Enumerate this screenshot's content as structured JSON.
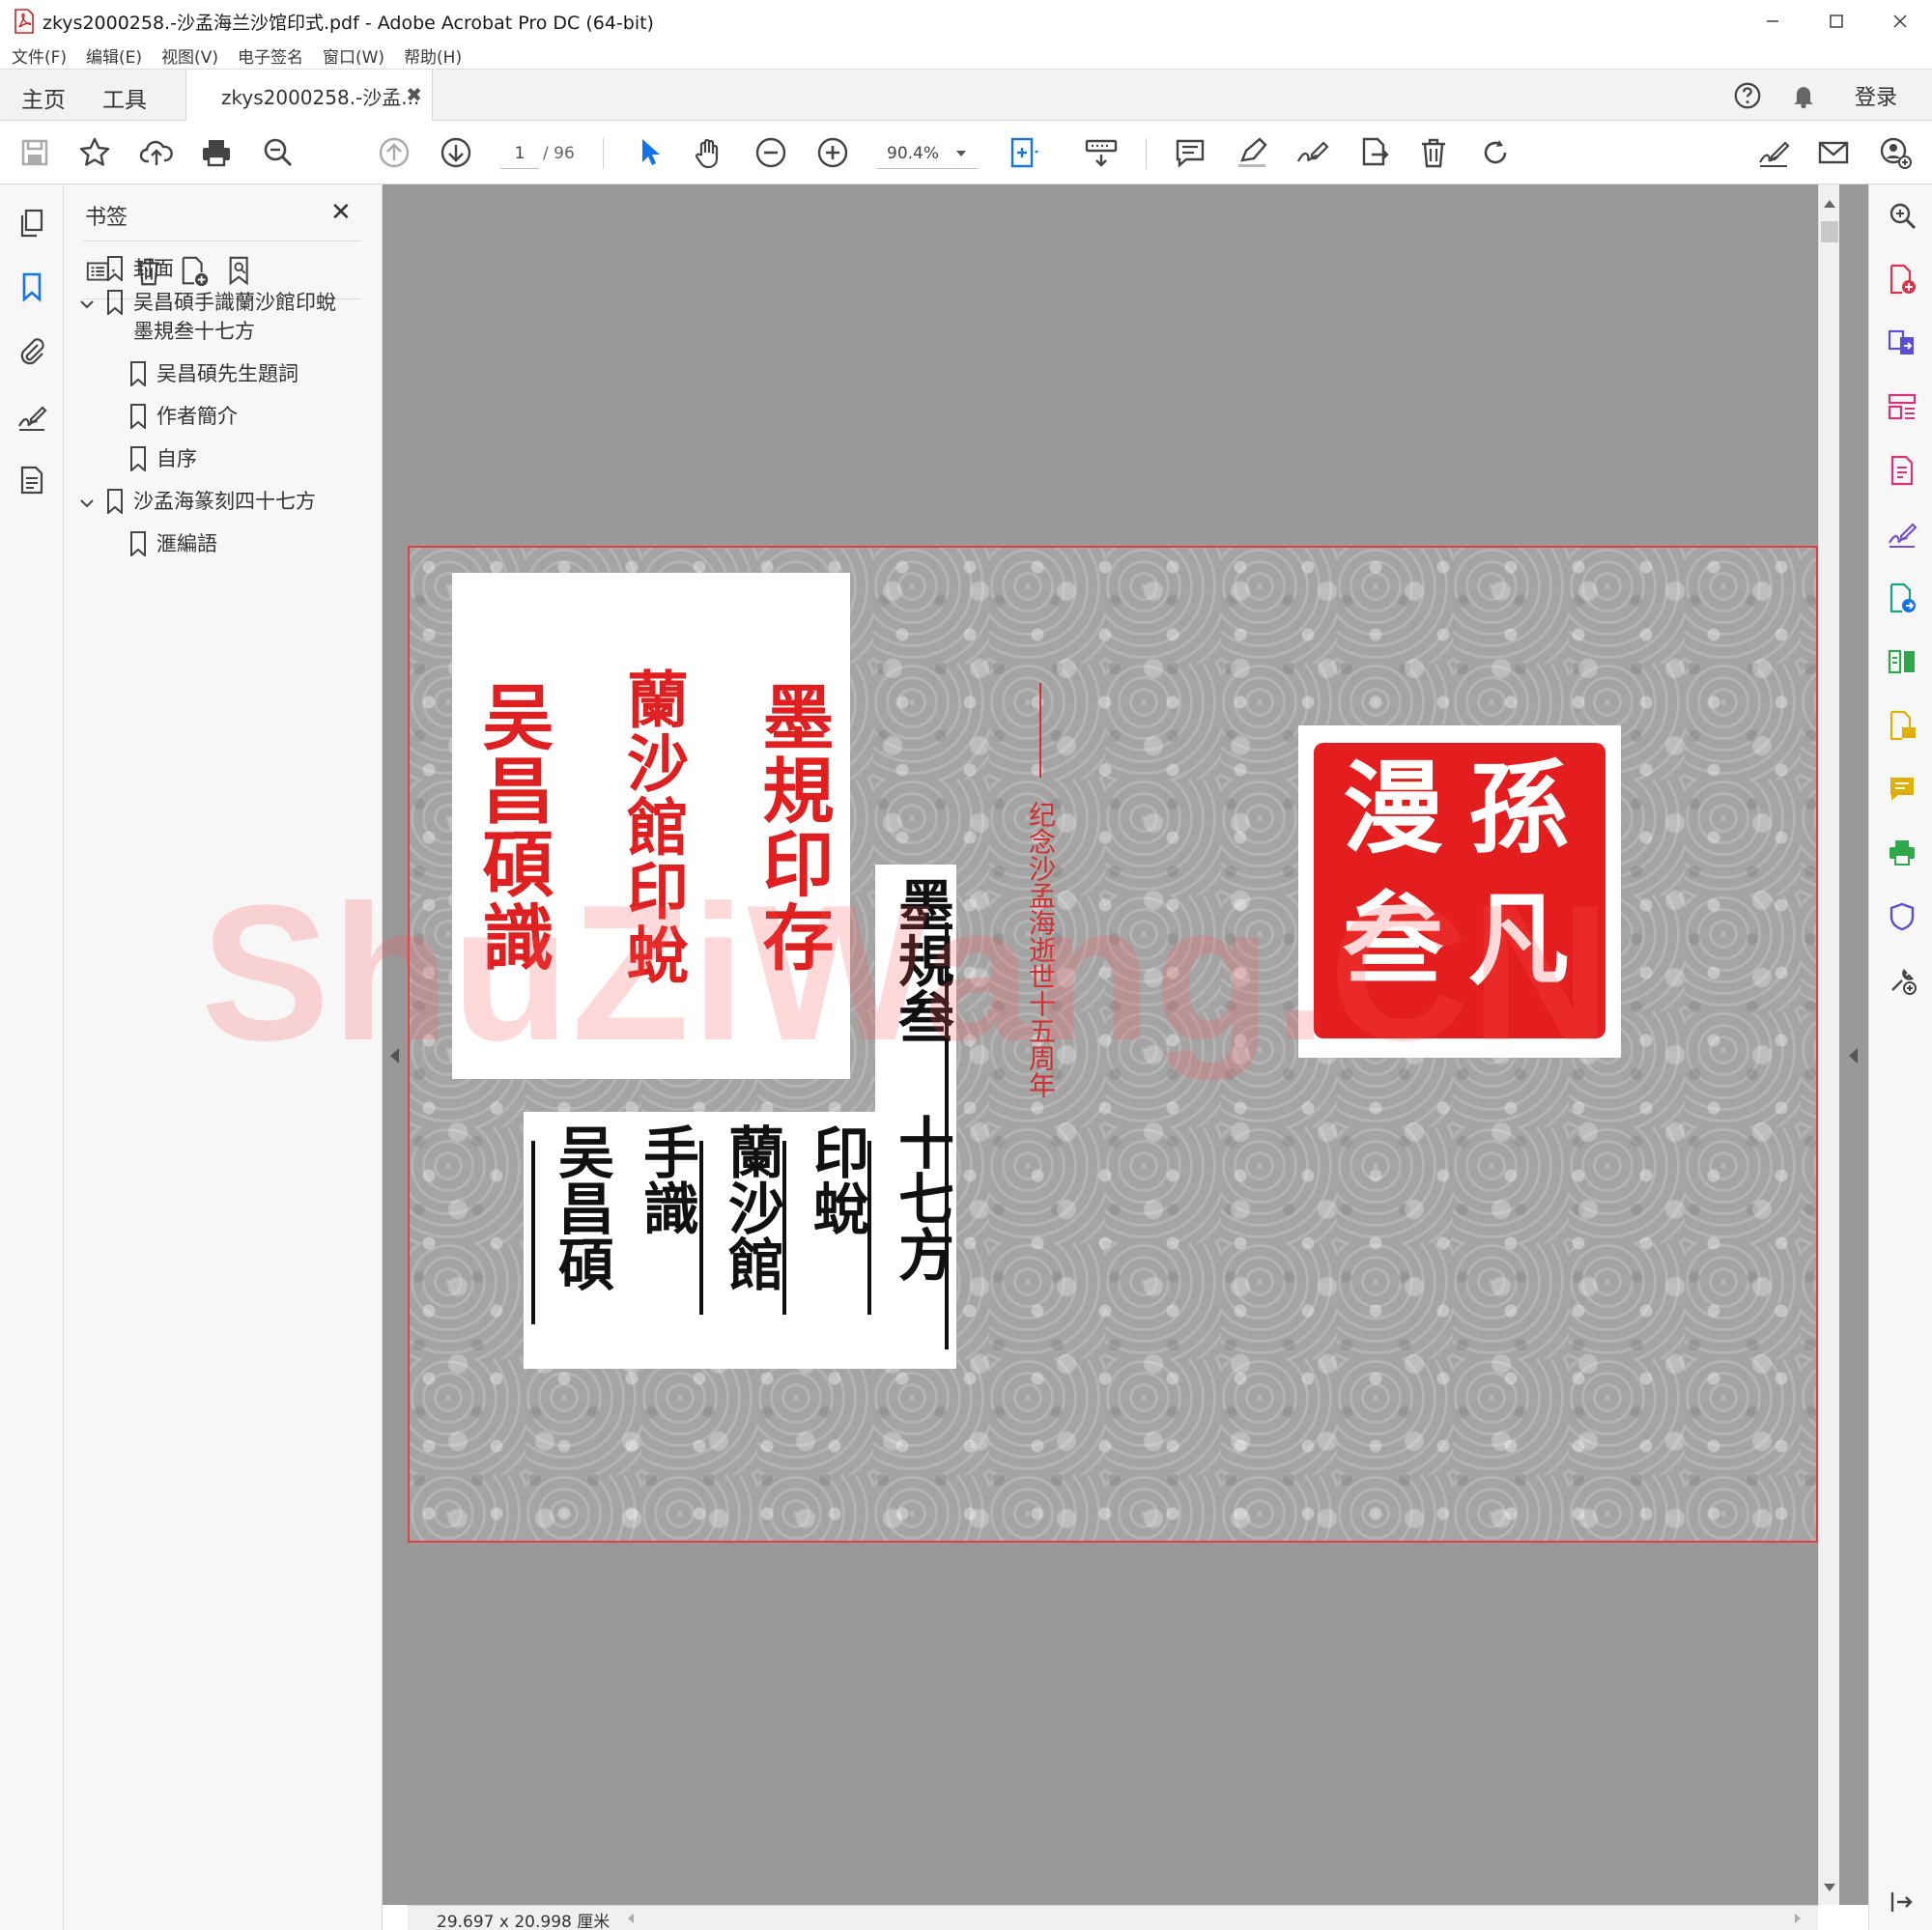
{
  "window": {
    "title": "zkys2000258.-沙孟海兰沙馆印式.pdf - Adobe Acrobat Pro DC (64-bit)",
    "controls": [
      "minimize-icon",
      "maximize-icon",
      "close-icon"
    ]
  },
  "menu": [
    "文件(F)",
    "编辑(E)",
    "视图(V)",
    "电子签名",
    "窗口(W)",
    "帮助(H)"
  ],
  "tabs": {
    "home": "主页",
    "tools": "工具",
    "document": "zkys2000258.-沙孟...",
    "close_symbol": "✖",
    "login": "登录"
  },
  "toolbar": {
    "page_current": "1",
    "page_total": "/ 96",
    "zoom": "90.4%",
    "icons": [
      "save-icon",
      "star-icon",
      "upload-cloud-icon",
      "print-icon",
      "find-zoom-icon",
      "prev-page-icon",
      "next-page-icon",
      "select-cursor-icon",
      "hand-icon",
      "zoom-out-icon",
      "zoom-in-icon",
      "fit-page-icon",
      "keyboard-scroll-icon",
      "comment-icon",
      "highlight-pen-icon",
      "sign-icon",
      "export-icon",
      "delete-icon",
      "rotate-icon",
      "fill-sign-icon",
      "email-icon",
      "add-user-icon"
    ]
  },
  "bookmarks": {
    "title": "书签",
    "close_symbol": "✕",
    "items": [
      {
        "label": "封面"
      },
      {
        "label": "吴昌碩手識蘭沙館印蛻",
        "label2": "墨規叁十七方"
      },
      {
        "label": "吴昌碩先生題詞"
      },
      {
        "label": "作者簡介"
      },
      {
        "label": "自序"
      },
      {
        "label": "沙孟海篆刻四十七方"
      },
      {
        "label": "滙編語"
      }
    ]
  },
  "page": {
    "seal_left_cols": [
      "墨規印存",
      "蘭沙館印蛻",
      "吴昌碩識"
    ],
    "title_cols": {
      "c1": "墨規叁",
      "c2": "十七方",
      "c3": "印蛻",
      "c4": "蘭沙館",
      "c5": "手識",
      "c6": "吴昌碩"
    },
    "anniversary": "纪念沙孟海逝世十五周年",
    "seal_right_chars": [
      "孫",
      "凡",
      "漫",
      "叁"
    ],
    "watermark": "ShuZiWang.CN"
  },
  "status": {
    "page_size": "29.697 x 20.998 厘米"
  },
  "colors": {
    "seal_red": "#e41e1e",
    "accent_blue": "#1473e6",
    "page_gray": "#a4a4a4"
  }
}
